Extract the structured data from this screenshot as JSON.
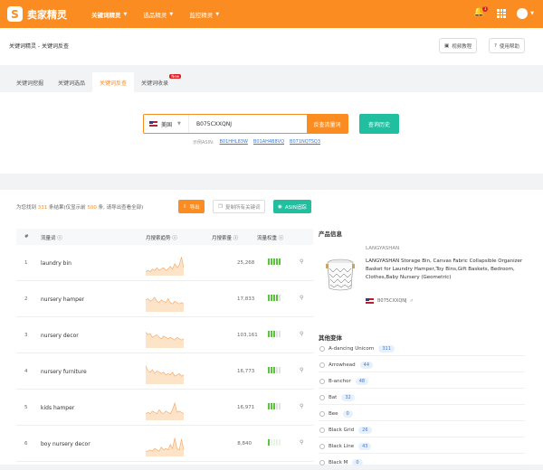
{
  "brand": {
    "logo_char": "S",
    "name": "卖家精灵"
  },
  "nav": [
    {
      "label": "关键词精灵"
    },
    {
      "label": "选品精灵"
    },
    {
      "label": "监控精灵"
    }
  ],
  "notifications": {
    "count": "1"
  },
  "breadcrumb": "关键词精灵 - 关键词反查",
  "header_buttons": {
    "video": "视频教程",
    "help": "使用帮助"
  },
  "tabs": [
    {
      "label": "关键词挖掘"
    },
    {
      "label": "关键词选品"
    },
    {
      "label": "关键词反查"
    },
    {
      "label": "关键词收录",
      "badge": "New"
    }
  ],
  "search": {
    "country": "美国",
    "asin_value": "B075CXXQNJ",
    "reverse_button": "反查流量词",
    "history_button": "查询历史",
    "examples_label": "示例ASIN:",
    "examples": [
      "B01HHL83W",
      "B01AH4B8VQ",
      "B071NQTSQ3"
    ]
  },
  "summary": {
    "prefix": "为您找到",
    "count": "331",
    "middle": "条结果(仅显示前",
    "limit": "500",
    "suffix": "条, 请导出查看全部)"
  },
  "result_buttons": {
    "export": "导出",
    "copy": "复制所有关键词",
    "asin_watch": "ASIN追踪"
  },
  "table": {
    "headers": [
      "#",
      "流量词",
      "月搜索趋势",
      "月搜索量",
      "流量权重"
    ],
    "rows": [
      {
        "num": "1",
        "keyword": "laundry bin",
        "volume": "25,268",
        "weight": 5,
        "trend": [
          3,
          4,
          3,
          5,
          4,
          6,
          4,
          5,
          6,
          4,
          5,
          7,
          5,
          9,
          6,
          8,
          14,
          6
        ]
      },
      {
        "num": "2",
        "keyword": "nursery hamper",
        "volume": "17,833",
        "weight": 4,
        "trend": [
          9,
          10,
          8,
          9,
          11,
          8,
          7,
          9,
          8,
          7,
          10,
          7,
          6,
          8,
          7,
          6,
          7,
          6
        ]
      },
      {
        "num": "3",
        "keyword": "nursery decor",
        "volume": "103,161",
        "weight": 3,
        "trend": [
          12,
          10,
          11,
          8,
          9,
          10,
          8,
          7,
          9,
          8,
          7,
          8,
          7,
          6,
          8,
          7,
          6,
          7
        ]
      },
      {
        "num": "4",
        "keyword": "nursery furniture",
        "volume": "16,773",
        "weight": 3,
        "trend": [
          14,
          10,
          9,
          11,
          8,
          10,
          9,
          8,
          9,
          7,
          8,
          7,
          9,
          6,
          7,
          8,
          6,
          7
        ]
      },
      {
        "num": "5",
        "keyword": "kids hamper",
        "volume": "16,971",
        "weight": 3,
        "trend": [
          5,
          6,
          5,
          7,
          6,
          5,
          8,
          6,
          5,
          7,
          6,
          5,
          8,
          13,
          6,
          7,
          6,
          5
        ]
      },
      {
        "num": "6",
        "keyword": "boy nursery decor",
        "volume": "8,840",
        "weight": 1,
        "trend": [
          4,
          4,
          5,
          4,
          6,
          5,
          4,
          7,
          5,
          6,
          5,
          9,
          6,
          14,
          6,
          5,
          13,
          5
        ]
      }
    ]
  },
  "product": {
    "section_title": "产品信息",
    "brand": "LANGYASHAN",
    "title": "LANGYASHAN Storage Bin,  Canvas Fabric Collapsible Organizer Basket for Laundry Hamper,Toy Bins,Gift Baskets, Bedroom, Clothes,Baby Nursery (Geometric)",
    "asin": "B075CXXQNJ"
  },
  "variants": {
    "title": "其他变体",
    "items": [
      {
        "name": "A-dancing Unicorn",
        "count": "311"
      },
      {
        "name": "Arrowhead",
        "count": "44"
      },
      {
        "name": "B-anchor",
        "count": "48"
      },
      {
        "name": "Bat",
        "count": "32"
      },
      {
        "name": "Bee",
        "count": "0"
      },
      {
        "name": "Black Grid",
        "count": "26"
      },
      {
        "name": "Black Line",
        "count": "43"
      },
      {
        "name": "Black M",
        "count": "0"
      }
    ]
  },
  "colors": {
    "brand_orange": "#fb8c22",
    "teal": "#1fbfa0",
    "weight_green": "#5cc340",
    "trend_fill": "#fde3c8",
    "trend_line": "#f6a45a"
  }
}
